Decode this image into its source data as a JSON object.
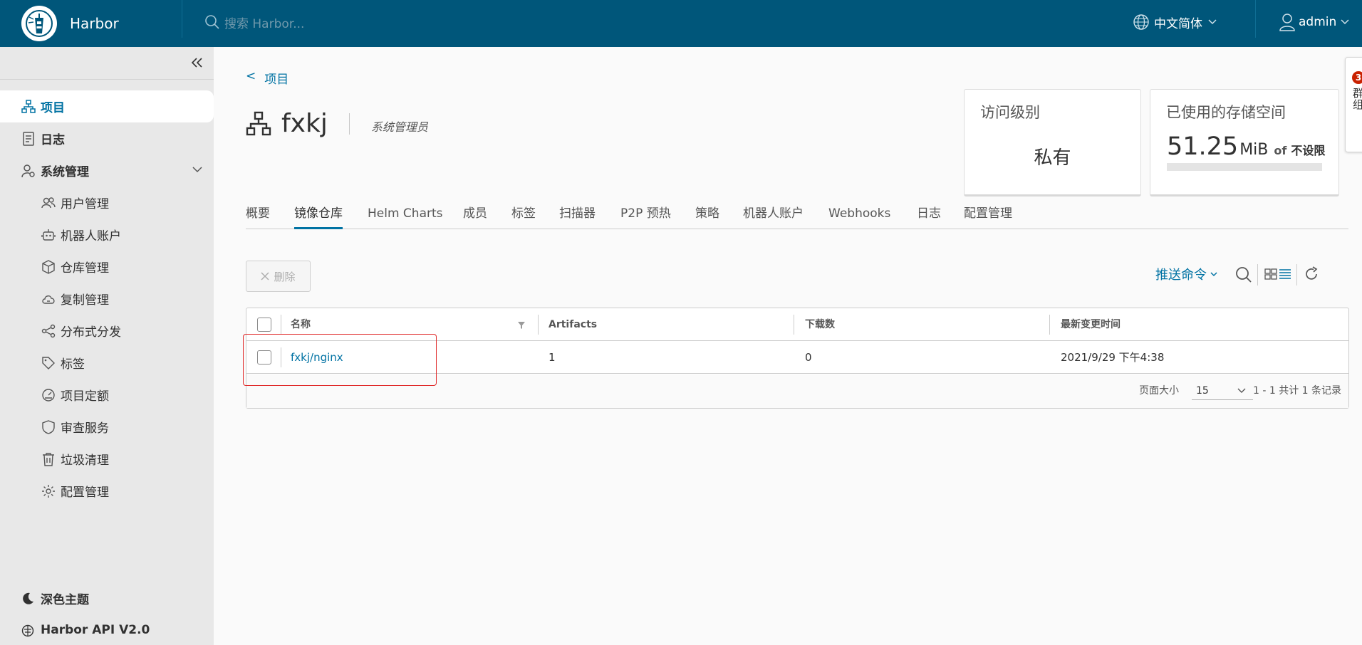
{
  "header": {
    "brand": "Harbor",
    "search_placeholder": "搜索 Harbor...",
    "language": "中文简体",
    "user": "admin"
  },
  "sidebar": {
    "items": [
      {
        "label": "项目",
        "icon": "projects-icon",
        "active": true
      },
      {
        "label": "日志",
        "icon": "logs-icon"
      },
      {
        "label": "系统管理",
        "icon": "admin-icon",
        "expanded": true
      }
    ],
    "sub_items": [
      {
        "label": "用户管理",
        "icon": "users-icon"
      },
      {
        "label": "机器人账户",
        "icon": "robot-icon"
      },
      {
        "label": "仓库管理",
        "icon": "registry-icon"
      },
      {
        "label": "复制管理",
        "icon": "replication-icon"
      },
      {
        "label": "分布式分发",
        "icon": "share-icon"
      },
      {
        "label": "标签",
        "icon": "tag-icon"
      },
      {
        "label": "项目定额",
        "icon": "quota-icon"
      },
      {
        "label": "审查服务",
        "icon": "shield-icon"
      },
      {
        "label": "垃圾清理",
        "icon": "trash-icon"
      },
      {
        "label": "配置管理",
        "icon": "gear-icon"
      }
    ],
    "dark_theme": "深色主题",
    "api": "Harbor API V2.0"
  },
  "breadcrumb": {
    "arrow": "<",
    "label": "项目"
  },
  "project": {
    "name": "fxkj",
    "role": "系统管理员"
  },
  "cards": {
    "access": {
      "title": "访问级别",
      "value": "私有"
    },
    "storage": {
      "title": "已使用的存储空间",
      "value": "51.25",
      "unit": "MiB",
      "of": "of",
      "limit": "不设限",
      "usage_fraction": 0
    }
  },
  "tabs": [
    "概要",
    "镜像仓库",
    "Helm Charts",
    "成员",
    "标签",
    "扫描器",
    "P2P 预热",
    "策略",
    "机器人账户",
    "Webhooks",
    "日志",
    "配置管理"
  ],
  "active_tab": "镜像仓库",
  "toolbar": {
    "delete": "删除",
    "push_command": "推送命令"
  },
  "table": {
    "columns": [
      "名称",
      "Artifacts",
      "下载数",
      "最新变更时间"
    ],
    "rows": [
      {
        "name": "fxkj/nginx",
        "artifacts": "1",
        "pulls": "0",
        "updated": "2021/9/29 下午4:38"
      }
    ],
    "footer": {
      "page_size_label": "页面大小",
      "page_size": "15",
      "summary": "1 - 1 共计 1 条记录"
    }
  },
  "side_tab": {
    "badge": "3",
    "label": "群组"
  },
  "colors": {
    "header": "#00567a",
    "accent": "#0072a3",
    "highlight_box": "#e02b2b"
  }
}
